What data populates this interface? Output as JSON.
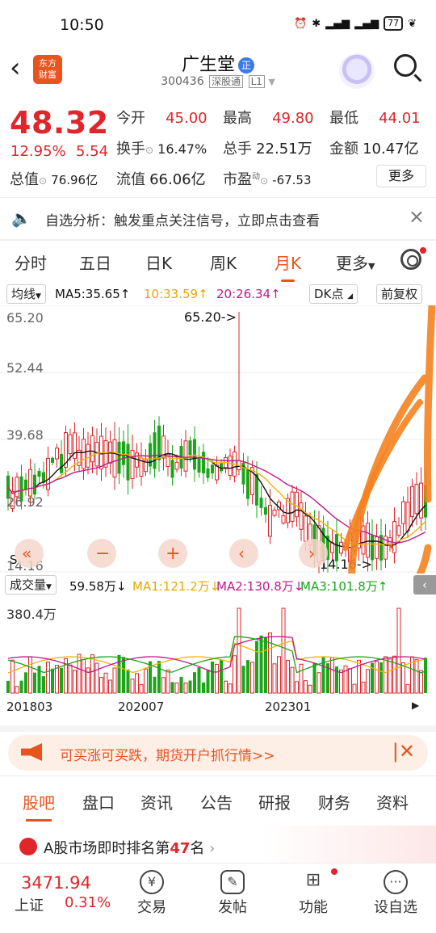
{
  "status": {
    "time": "10:50",
    "battery": "77"
  },
  "header": {
    "logo_line1": "东方",
    "logo_line2": "财富",
    "name": "广生堂",
    "zheng": "正",
    "code": "300436",
    "exchange": "深股通",
    "level": "L1"
  },
  "quote": {
    "price": "48.32",
    "pct": "12.95%",
    "chg": "5.54",
    "open_label": "今开",
    "open": "45.00",
    "high_label": "最高",
    "high": "49.80",
    "low_label": "最低",
    "low": "44.01",
    "turnover_label": "换手",
    "turnover": "16.47%",
    "volume_label": "总手",
    "volume": "22.51万",
    "amount_label": "金额",
    "amount": "10.47亿",
    "mktcap_label": "总值",
    "mktcap": "76.96亿",
    "float_label": "流值",
    "float": "66.06亿",
    "pe_label": "市盈",
    "pe_sup": "动",
    "pe": "-67.53",
    "more": "更多"
  },
  "alert": {
    "text": "自选分析：触发重点关注信号，立即点击查看"
  },
  "tabs": [
    "分时",
    "五日",
    "日K",
    "周K",
    "月K",
    "更多"
  ],
  "ma_bar": {
    "junxian": "均线",
    "ma5": "MA5:35.65↑",
    "ma10": "10:33.59↑",
    "ma20": "20:26.34↑",
    "dk": "DK点",
    "fq": "前复权"
  },
  "vol_bar": {
    "label": "成交量",
    "vol": "59.58万↓",
    "ma1": "MA1:121.2万↓",
    "ma2": "MA2:130.8万↓",
    "ma3": "MA3:101.8万↑"
  },
  "chart_data": {
    "type": "candlestick",
    "y_ticks": [
      "65.20",
      "52.44",
      "39.68",
      "26.92",
      "14.16"
    ],
    "max_label": "65.20->",
    "min_label": "14.16->",
    "s_mark": "S",
    "vol_tick": "380.4万",
    "x_ticks": [
      "201803",
      "202007",
      "202301"
    ]
  },
  "banner": {
    "text": "可买涨可买跌，期货开户抓行情>>"
  },
  "subtabs": [
    "股吧",
    "盘口",
    "资讯",
    "公告",
    "研报",
    "财务",
    "资料"
  ],
  "rank": {
    "prefix": "A股市场即时排名第",
    "num": "47",
    "suffix": "名"
  },
  "bottom": {
    "idx_val": "3471.94",
    "idx_name": "上证",
    "idx_pct": "0.31%",
    "nav": [
      "交易",
      "发帖",
      "功能",
      "设自选"
    ]
  },
  "colors": {
    "up": "#e0252b",
    "down": "#1aa51a",
    "accent": "#e8541d",
    "ma5": "#111111",
    "ma10": "#f0b400",
    "ma20": "#c0188c",
    "marker": "#f58220"
  }
}
